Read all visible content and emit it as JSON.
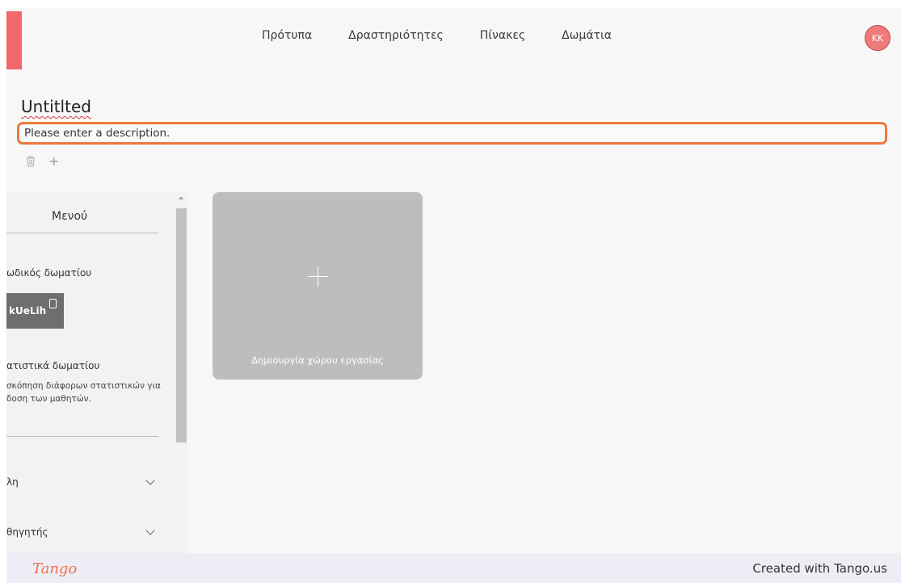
{
  "nav": {
    "items": [
      "Πρότυπα",
      "Δραστηριότητες",
      "Πίνακες",
      "Δωμάτια"
    ],
    "avatar": "KK"
  },
  "page": {
    "title": "Untitlted",
    "description_value": "Please enter a description."
  },
  "toolbar": {
    "add_label": "+"
  },
  "sidebar": {
    "menu_title": "Μενού",
    "code_label": "ωδικός δωματίου",
    "code_value": "kUeLih",
    "stats_title": "ατιστικά δωματίου",
    "stats_desc": "σκόπηση διάφορων στατιστικών για\nδοση των μαθητών.",
    "accordions": [
      "λη",
      "θηγητής"
    ]
  },
  "card": {
    "label": "Δημιουργία χώρου εργασίας"
  },
  "footer": {
    "brand": "Tango",
    "created": "Created with Tango.us"
  },
  "colors": {
    "accent": "#f0773d",
    "logo": "#f26868",
    "avatar": "#f07a7a"
  }
}
